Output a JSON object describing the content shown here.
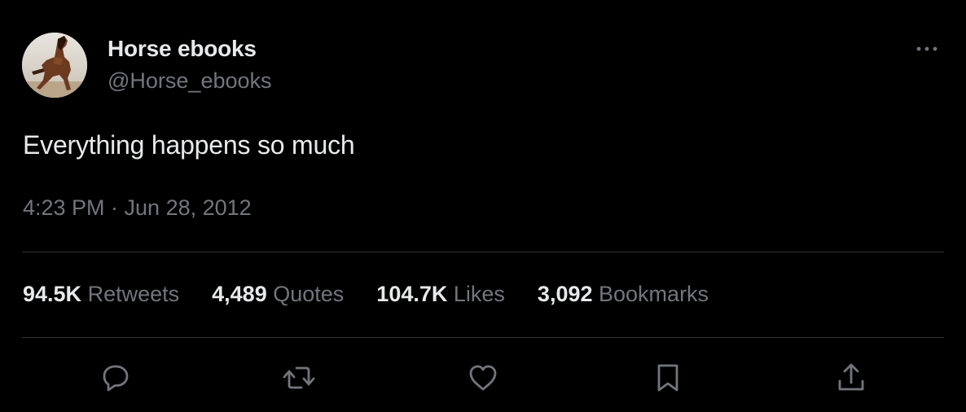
{
  "author": {
    "display_name": "Horse ebooks",
    "handle": "@Horse_ebooks",
    "avatar_icon": "horse-avatar"
  },
  "tweet": {
    "text": "Everything happens so much",
    "timestamp": "4:23 PM · Jun 28, 2012"
  },
  "stats": [
    {
      "value": "94.5K",
      "label": "Retweets"
    },
    {
      "value": "4,489",
      "label": "Quotes"
    },
    {
      "value": "104.7K",
      "label": "Likes"
    },
    {
      "value": "3,092",
      "label": "Bookmarks"
    }
  ],
  "actions": [
    {
      "icon": "reply-icon"
    },
    {
      "icon": "retweet-icon"
    },
    {
      "icon": "like-icon"
    },
    {
      "icon": "bookmark-icon"
    },
    {
      "icon": "share-icon"
    }
  ],
  "colors": {
    "background": "#000000",
    "primary_text": "#e7e9ea",
    "secondary_text": "#71767b",
    "divider": "#2f3336"
  }
}
